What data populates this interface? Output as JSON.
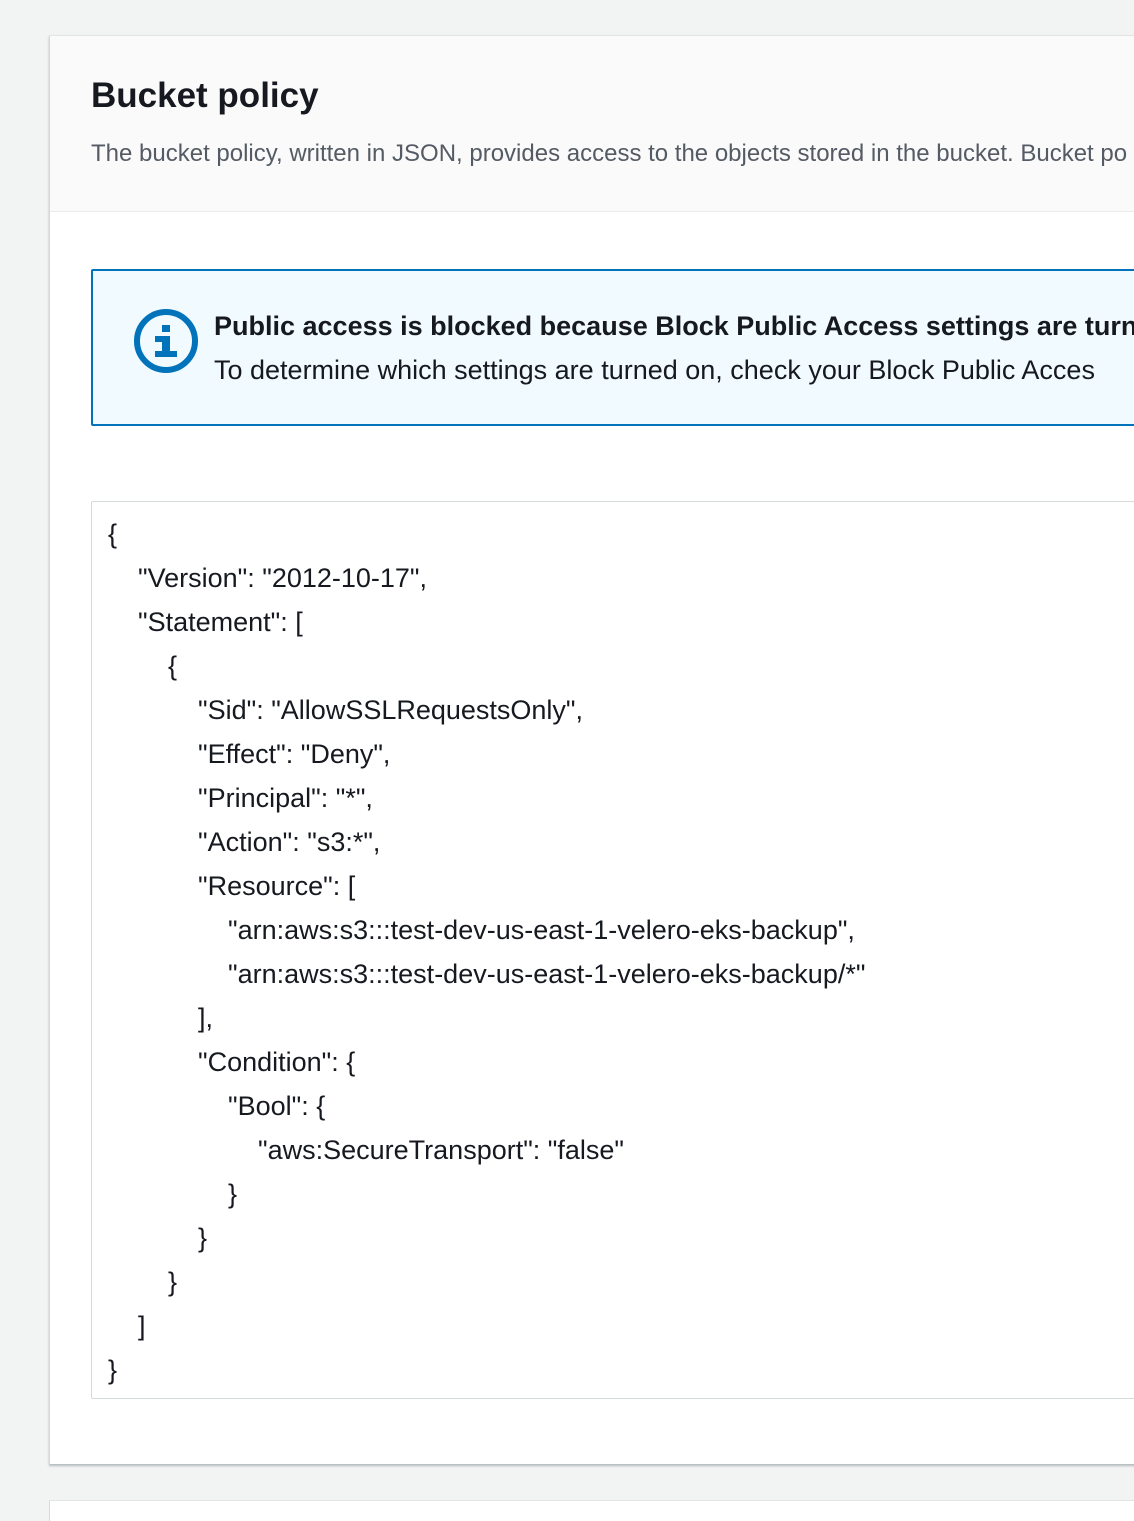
{
  "panel": {
    "title": "Bucket policy",
    "description": "The bucket policy, written in JSON, provides access to the objects stored in the bucket. Bucket po"
  },
  "alert": {
    "icon": "info-icon",
    "accent_color": "#0073bb",
    "background_color": "#f1faff",
    "title": "Public access is blocked because Block Public Access settings are turne",
    "body": "To determine which settings are turned on, check your Block Public Acces"
  },
  "policy": {
    "json": "{\n    \"Version\": \"2012-10-17\",\n    \"Statement\": [\n        {\n            \"Sid\": \"AllowSSLRequestsOnly\",\n            \"Effect\": \"Deny\",\n            \"Principal\": \"*\",\n            \"Action\": \"s3:*\",\n            \"Resource\": [\n                \"arn:aws:s3:::test-dev-us-east-1-velero-eks-backup\",\n                \"arn:aws:s3:::test-dev-us-east-1-velero-eks-backup/*\"\n            ],\n            \"Condition\": {\n                \"Bool\": {\n                    \"aws:SecureTransport\": \"false\"\n                }\n            }\n        }\n    ]\n}"
  }
}
